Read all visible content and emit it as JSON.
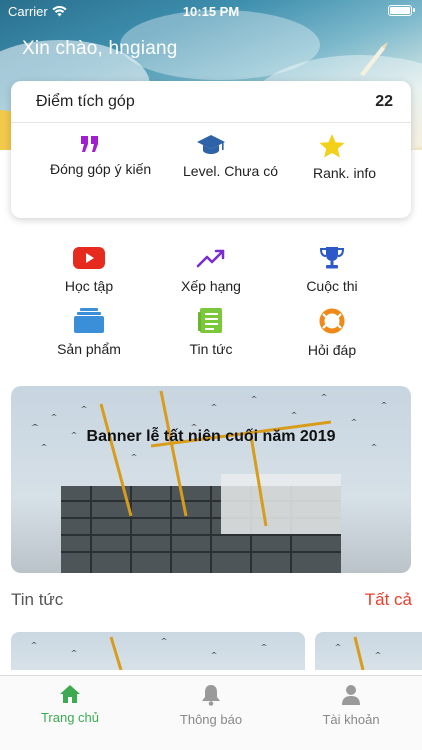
{
  "status_bar": {
    "carrier": "Carrier",
    "time": "10:15 PM"
  },
  "greeting": "Xin chào, hngiang",
  "points_card": {
    "label": "Điểm tích góp",
    "value": "22",
    "items": [
      {
        "label": "Đóng góp ý kiến",
        "icon": "quote-icon",
        "color": "#a11fd1"
      },
      {
        "label": "Level. Chưa có",
        "icon": "graduation-cap-icon",
        "color": "#2f63a8"
      },
      {
        "label": "Rank. info",
        "icon": "star-icon",
        "color": "#f3d11b"
      }
    ]
  },
  "menu": [
    {
      "label": "Học tập",
      "icon": "youtube-icon",
      "color": "#e62b1e"
    },
    {
      "label": "Xếp hạng",
      "icon": "trending-up-icon",
      "color": "#7a2bd1"
    },
    {
      "label": "Cuộc thi",
      "icon": "trophy-icon",
      "color": "#2d58c7"
    },
    {
      "label": "Sản phẩm",
      "icon": "stack-icon",
      "color": "#3a8fd8"
    },
    {
      "label": "Tin tức",
      "icon": "newspaper-icon",
      "color": "#7bc83b"
    },
    {
      "label": "Hỏi đáp",
      "icon": "lifebuoy-icon",
      "color": "#ef8a1a"
    }
  ],
  "banner": {
    "title": "Banner lễ tất niên cuối năm 2019"
  },
  "news_section": {
    "label": "Tin tức",
    "see_all": "Tất cả"
  },
  "tabbar": [
    {
      "label": "Trang chủ",
      "icon": "home-icon",
      "active": true
    },
    {
      "label": "Thông báo",
      "icon": "bell-icon",
      "active": false
    },
    {
      "label": "Tài khoản",
      "icon": "user-icon",
      "active": false
    }
  ],
  "colors": {
    "accent": "#3daa52",
    "see_all": "#e8402d"
  }
}
